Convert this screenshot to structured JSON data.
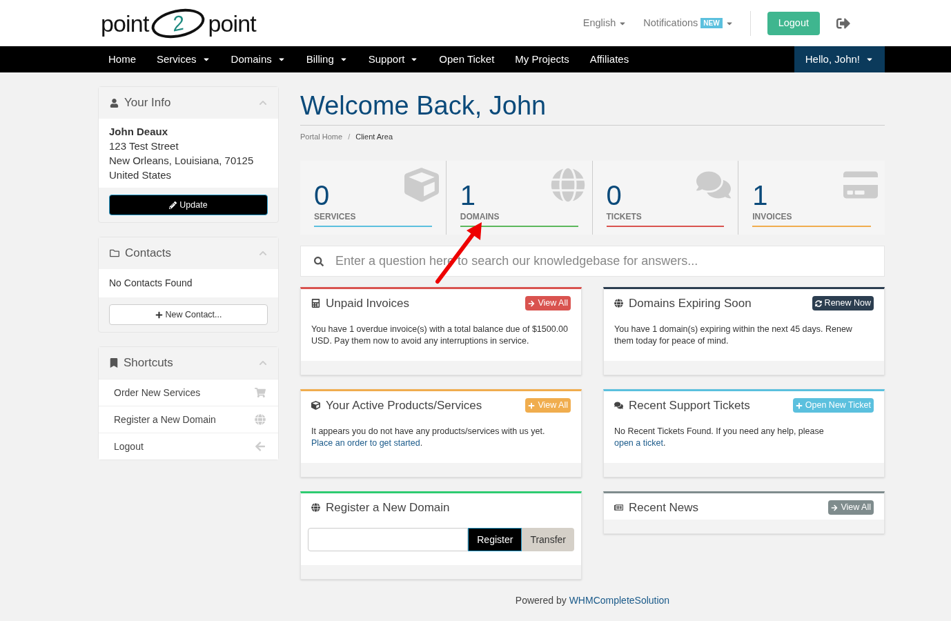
{
  "logo": {
    "left": "point",
    "middle": "2",
    "right": "point"
  },
  "topbar": {
    "language": "English",
    "notifications": "Notifications",
    "notifications_badge": "NEW",
    "logout": "Logout"
  },
  "nav": {
    "items": [
      {
        "label": "Home",
        "dropdown": false
      },
      {
        "label": "Services",
        "dropdown": true
      },
      {
        "label": "Domains",
        "dropdown": true
      },
      {
        "label": "Billing",
        "dropdown": true
      },
      {
        "label": "Support",
        "dropdown": true
      },
      {
        "label": "Open Ticket",
        "dropdown": false
      },
      {
        "label": "My Projects",
        "dropdown": false
      },
      {
        "label": "Affiliates",
        "dropdown": false
      }
    ],
    "user": "Hello, John!"
  },
  "sidebar": {
    "your_info": {
      "title": "Your Info",
      "name": "John Deaux",
      "lines": [
        "123 Test Street",
        "New Orleans, Louisiana, 70125",
        "United States"
      ],
      "button": "Update"
    },
    "contacts": {
      "title": "Contacts",
      "empty": "No Contacts Found",
      "button": "New Contact..."
    },
    "shortcuts": {
      "title": "Shortcuts",
      "items": [
        "Order New Services",
        "Register a New Domain",
        "Logout"
      ]
    }
  },
  "page_title": "Welcome Back, John",
  "breadcrumb": {
    "items": [
      "Portal Home",
      "Client Area"
    ],
    "separator": "/"
  },
  "stats": [
    {
      "count": "0",
      "label": "SERVICES",
      "color": "#5bc0de"
    },
    {
      "count": "1",
      "label": "DOMAINS",
      "color": "#5cb85c"
    },
    {
      "count": "0",
      "label": "TICKETS",
      "color": "#d9534f"
    },
    {
      "count": "1",
      "label": "INVOICES",
      "color": "#f0ad4e"
    }
  ],
  "search": {
    "placeholder": "Enter a question here to search our knowledgebase for answers..."
  },
  "panels_left": [
    {
      "kind": "text",
      "title": "Unpaid Invoices",
      "button": "View All",
      "color": "#d9534f",
      "text": "You have 1 overdue invoice(s) with a total balance due of $1500.00 USD. Pay them now to avoid any interruptions in service."
    },
    {
      "kind": "text",
      "title": "Your Active Products/Services",
      "button": "View All",
      "color": "#f0ad4e",
      "text": "It appears you do not have any products/services with us yet.",
      "link": "Place an order to get started",
      "after": "."
    },
    {
      "kind": "domain_form",
      "title": "Register a New Domain",
      "color": "#2ecc71",
      "register": "Register",
      "transfer": "Transfer"
    }
  ],
  "panels_right": [
    {
      "kind": "text",
      "title": "Domains Expiring Soon",
      "button": "Renew Now",
      "color": "#2c3e50",
      "text": "You have 1 domain(s) expiring within the next 45 days. Renew them today for peace of mind."
    },
    {
      "kind": "text",
      "title": "Recent Support Tickets",
      "button": "Open New Ticket",
      "color": "#5bc0de",
      "text": "No Recent Tickets Found. If you need any help, please",
      "link": "open a ticket",
      "after": "."
    },
    {
      "kind": "header_only",
      "title": "Recent News",
      "button": "View All",
      "color": "#7f8c8d"
    }
  ],
  "footer": {
    "text": "Powered by",
    "link": "WHMCompleteSolution"
  }
}
